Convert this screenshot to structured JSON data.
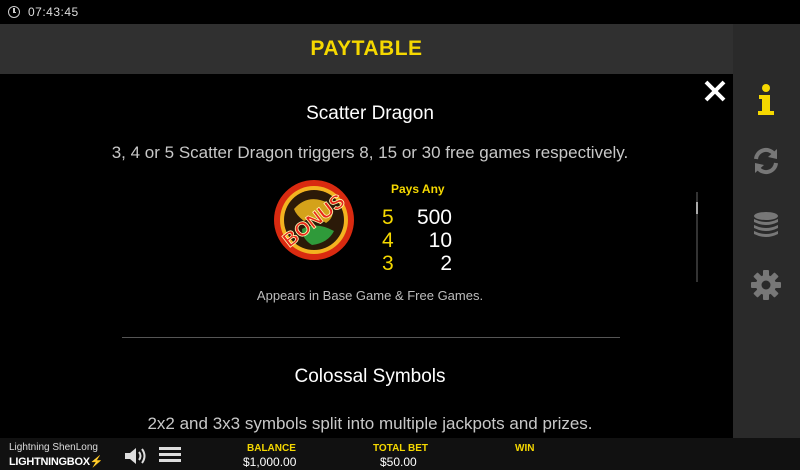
{
  "status": {
    "time": "07:43:45"
  },
  "header": {
    "title": "PAYTABLE"
  },
  "sections": {
    "scatter": {
      "title": "Scatter Dragon",
      "description": "3, 4 or 5 Scatter Dragon triggers 8, 15 or 30 free games respectively.",
      "symbol_text": "BONUS",
      "pays_label": "Pays Any",
      "pays": [
        {
          "count": "5",
          "amount": "500"
        },
        {
          "count": "4",
          "amount": "10"
        },
        {
          "count": "3",
          "amount": "2"
        }
      ],
      "note": "Appears in Base Game & Free Games."
    },
    "colossal": {
      "title": "Colossal Symbols",
      "description": "2x2 and 3x3 symbols split into multiple jackpots and prizes."
    }
  },
  "sidebar": {
    "items": [
      {
        "icon": "info-icon",
        "active": true
      },
      {
        "icon": "refresh-icon"
      },
      {
        "icon": "coin-stack-icon"
      },
      {
        "icon": "gear-icon"
      }
    ]
  },
  "bottombar": {
    "game_name": "Lightning ShenLong",
    "brand": "LIGHTNINGBOX",
    "balance_label": "BALANCE",
    "balance_value": "$1,000.00",
    "total_bet_label": "TOTAL BET",
    "total_bet_value": "$50.00",
    "win_label": "WIN"
  },
  "colors": {
    "accent": "#f5d800",
    "sidebar": "#2a2a2a",
    "header": "#303030"
  }
}
